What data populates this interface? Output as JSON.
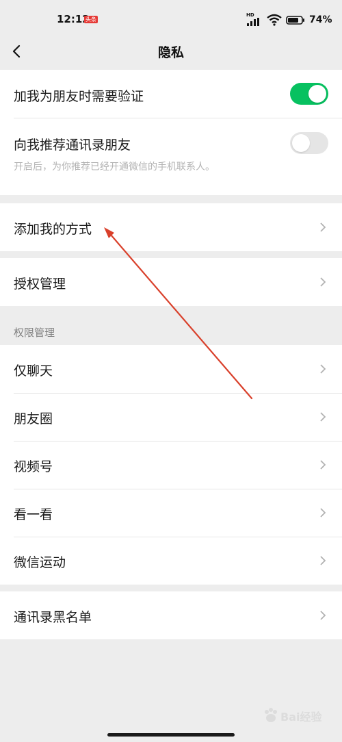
{
  "status_bar": {
    "time": "12:12",
    "badge": "头条",
    "network_label": "HD",
    "battery": "74%"
  },
  "nav": {
    "title": "隐私"
  },
  "privacy": {
    "verify_label": "加我为朋友时需要验证",
    "verify_on": true,
    "recommend_label": "向我推荐通讯录朋友",
    "recommend_on": false,
    "recommend_hint": "开启后，为你推荐已经开通微信的手机联系人。"
  },
  "add_me_label": "添加我的方式",
  "auth_label": "授权管理",
  "permissions": {
    "header": "权限管理",
    "items": [
      "仅聊天",
      "朋友圈",
      "视频号",
      "看一看",
      "微信运动"
    ]
  },
  "blacklist_label": "通讯录黑名单",
  "annotation": {
    "arrow_color": "#d9402b"
  },
  "colors": {
    "accent": "#07c160",
    "background": "#ededed"
  },
  "watermark": {
    "text": "Bai经验"
  }
}
